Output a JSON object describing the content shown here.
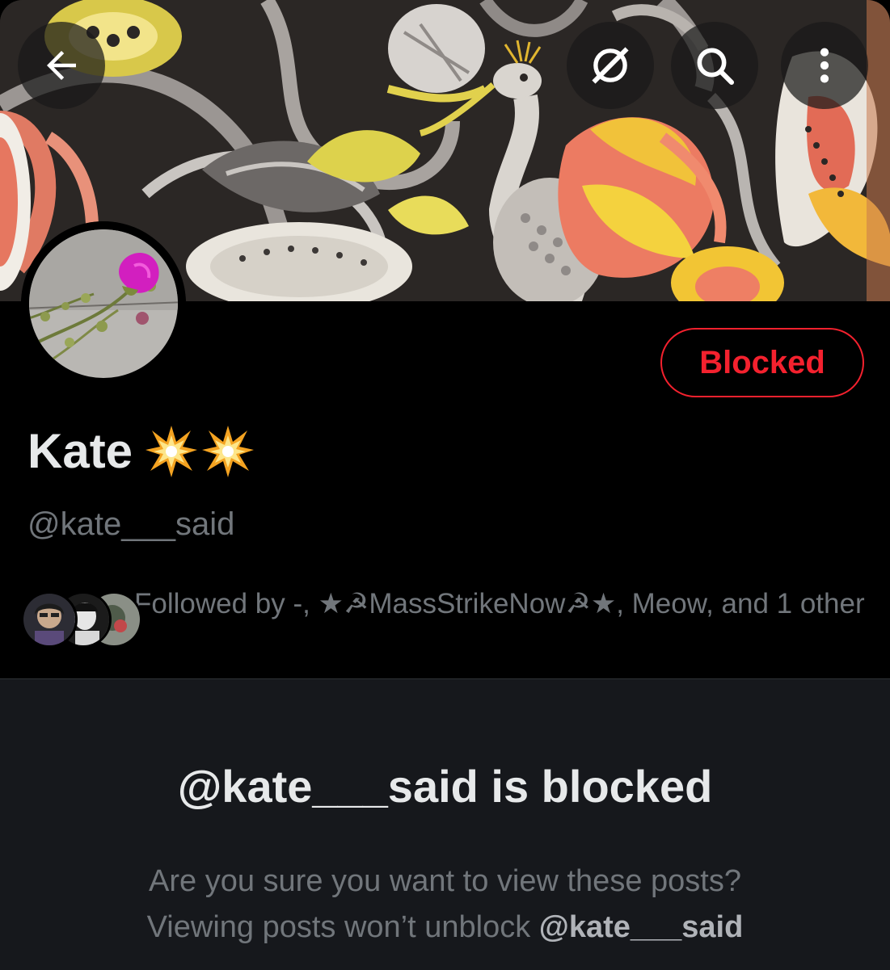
{
  "topbar": {
    "back_icon": "arrow-left-icon",
    "grok_icon": "grok-slash-icon",
    "search_icon": "search-icon",
    "more_icon": "more-vertical-icon"
  },
  "profile": {
    "display_name": "Kate",
    "name_emojis": [
      "💥",
      "💥"
    ],
    "handle": "@kate___said",
    "action_button": "Blocked",
    "followed_by": "Followed by -, ★☭MassStrikeNow☭★, Meow, and 1 other"
  },
  "blocked_notice": {
    "title": "@kate___said is blocked",
    "line1": "Are you sure you want to view these posts?",
    "line2_prefix": "Viewing posts won’t unblock ",
    "line2_handle": "@kate___said"
  },
  "colors": {
    "background": "#000000",
    "panel": "#16181c",
    "danger": "#f4212e",
    "text_primary": "#e7e9ea",
    "text_secondary": "#71767b"
  }
}
